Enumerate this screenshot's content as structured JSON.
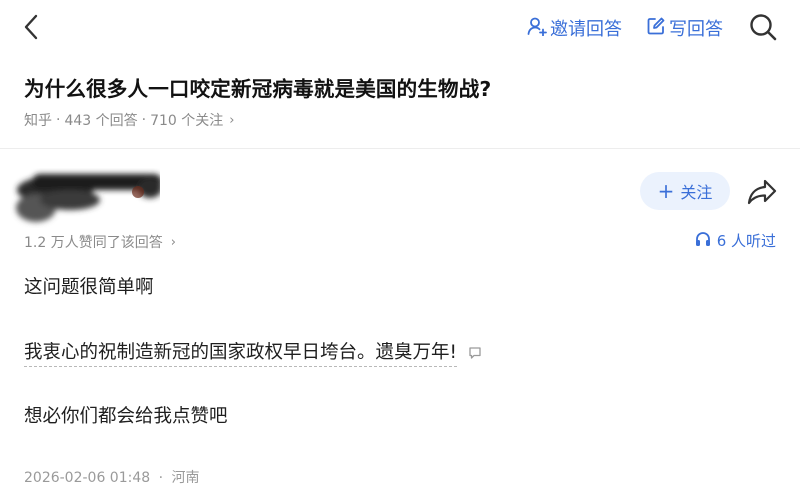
{
  "header": {
    "invite_label": "邀请回答",
    "write_label": "写回答",
    "accent_color": "#3a6fd8",
    "icons": [
      "back-arrow-icon",
      "invite-person-icon",
      "write-edit-icon",
      "search-icon"
    ]
  },
  "question": {
    "title": "为什么很多人一口咬定新冠病毒就是美国的生物战?",
    "source": "知乎",
    "separator": "·",
    "answers": "443 个回答",
    "followers": "710 个关注",
    "chevron": "›"
  },
  "answer": {
    "follow_label": "关注",
    "follow_plus": "+",
    "agree_text": "1.2 万人赞同了该回答",
    "listen_text": "6 人听过",
    "paragraphs": [
      "这问题很简单啊",
      "我衷心的祝制造新冠的国家政权早日垮台。遗臭万年!",
      "想必你们都会给我点赞吧"
    ],
    "date": "2026-02-06 01:48",
    "location": "河南",
    "icons": [
      "redacted-avatar",
      "share-icon",
      "headphones-icon",
      "comment-icon"
    ]
  }
}
